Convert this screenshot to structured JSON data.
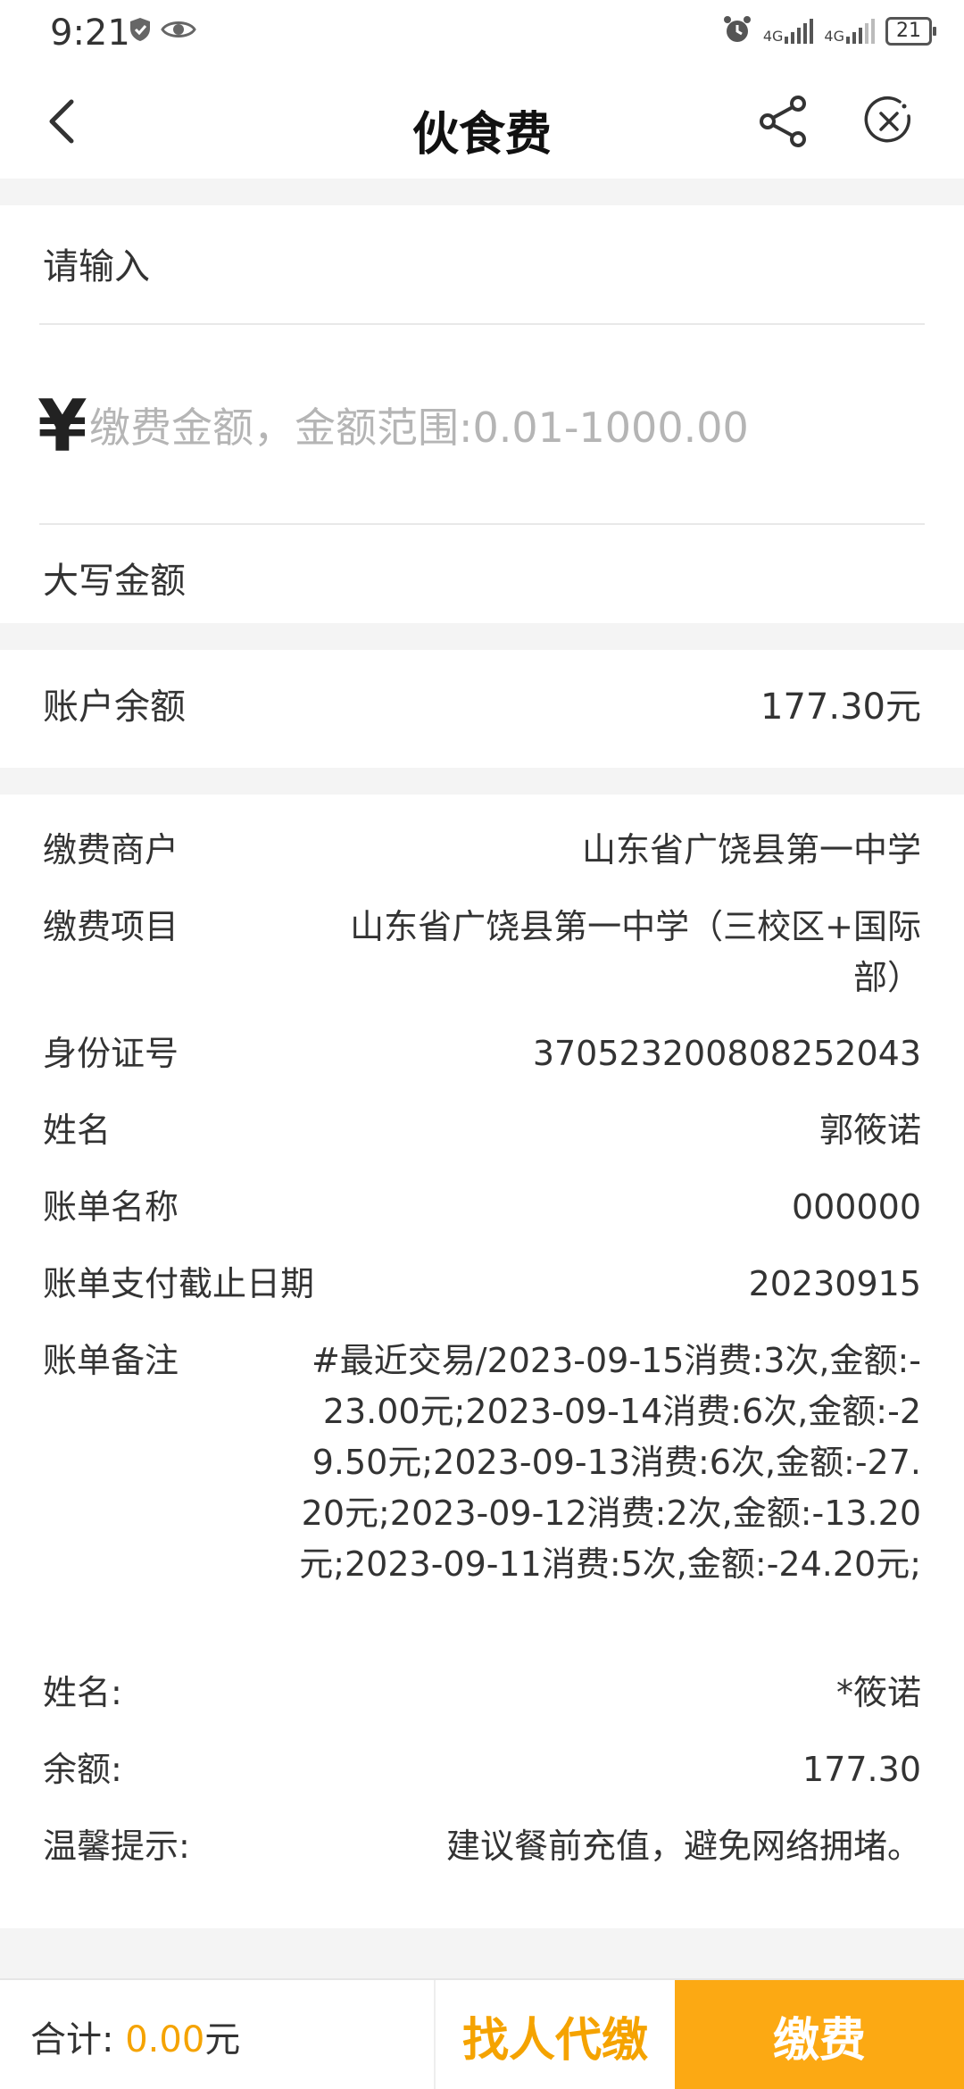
{
  "status_bar": {
    "time": "9:21",
    "battery": "21",
    "signal_1": "4G",
    "signal_2": "4G"
  },
  "nav": {
    "title": "伙食费"
  },
  "input_card": {
    "label": "请输入",
    "currency_symbol": "¥",
    "amount_placeholder": "缴费金额，金额范围:0.01-1000.00",
    "uppercase_label": "大写金额"
  },
  "balance": {
    "label": "账户余额",
    "value": "177.30元"
  },
  "details": [
    {
      "label": "缴费商户",
      "value": "山东省广饶县第一中学"
    },
    {
      "label": "缴费项目",
      "value": "山东省广饶县第一中学（三校区+国际部）"
    },
    {
      "label": "身份证号",
      "value": "370523200808252043"
    },
    {
      "label": "姓名",
      "value": "郭筱诺"
    },
    {
      "label": "账单名称",
      "value": "000000"
    },
    {
      "label": "账单支付截止日期",
      "value": "20230915"
    },
    {
      "label": "账单备注",
      "value": "#最近交易/2023-09-15消费:3次,金额:-23.00元;2023-09-14消费:6次,金额:-29.50元;2023-09-13消费:6次,金额:-27.20元;2023-09-12消费:2次,金额:-13.20元;2023-09-11消费:5次,金额:-24.20元;"
    },
    {
      "label": "姓名:",
      "value": "*筱诺"
    },
    {
      "label": "余额:",
      "value": "177.30"
    },
    {
      "label": "温馨提示:",
      "value": "建议餐前充值，避免网络拥堵。"
    }
  ],
  "bottom": {
    "total_label": "合计:",
    "total_amount": "0.00",
    "total_unit": "元",
    "proxy_button": "找人代缴",
    "pay_button": "缴费"
  },
  "colors": {
    "accent": "#f5a300",
    "pay_button_bg": "#fca913"
  }
}
